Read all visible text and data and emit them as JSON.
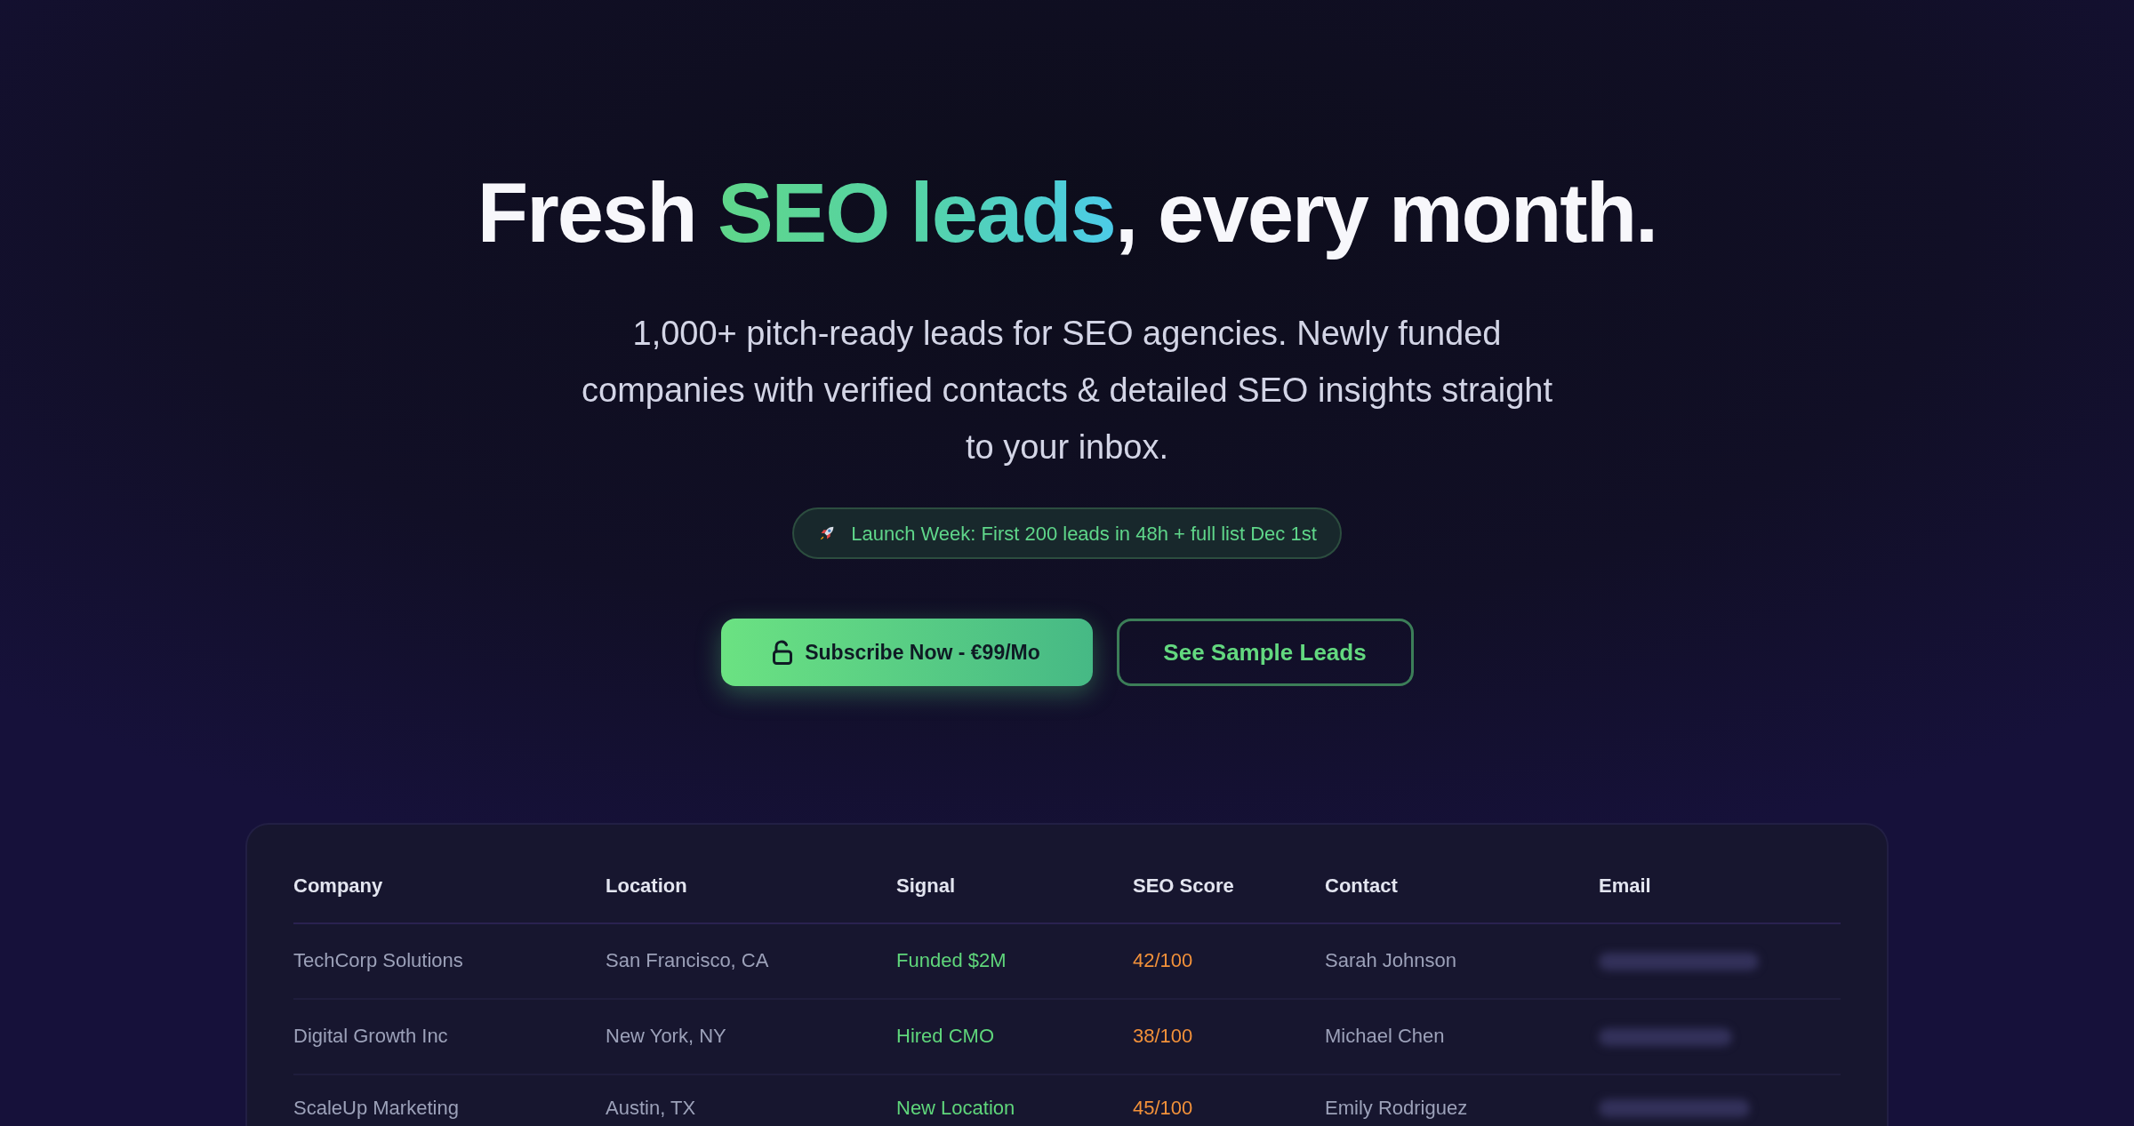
{
  "hero": {
    "heading": [
      {
        "text": "Fresh ",
        "kind": "plain"
      },
      {
        "text": "SEO leads",
        "kind": "gradient"
      },
      {
        "text": ", every month.",
        "kind": "plain"
      }
    ],
    "subtitle": "1,000+ pitch-ready leads for SEO agencies. Newly funded companies with verified contacts & detailed SEO insights straight to your inbox.",
    "badge": "Launch Week: First 200 leads in 48h + full list Dec 1st",
    "buttons": [
      {
        "label": "Subscribe Now - €99/Mo",
        "kind": "primary"
      },
      {
        "label": "See Sample Leads",
        "kind": "outline"
      }
    ]
  },
  "table": {
    "columns": [
      "Company",
      "Location",
      "Signal",
      "SEO Score",
      "Contact",
      "Email"
    ],
    "rows": [
      {
        "company": "TechCorp Solutions",
        "location": "San Francisco, CA",
        "signal": "Funded $2M",
        "seo_score": "42/100",
        "contact": "Sarah Johnson",
        "email_hidden": true
      },
      {
        "company": "Digital Growth Inc",
        "location": "New York, NY",
        "signal": "Hired CMO",
        "seo_score": "38/100",
        "contact": "Michael Chen",
        "email_hidden": true
      },
      {
        "company": "ScaleUp Marketing",
        "location": "Austin, TX",
        "signal": "New Location",
        "seo_score": "45/100",
        "contact": "Emily Rodriguez",
        "email_hidden": true
      }
    ]
  }
}
